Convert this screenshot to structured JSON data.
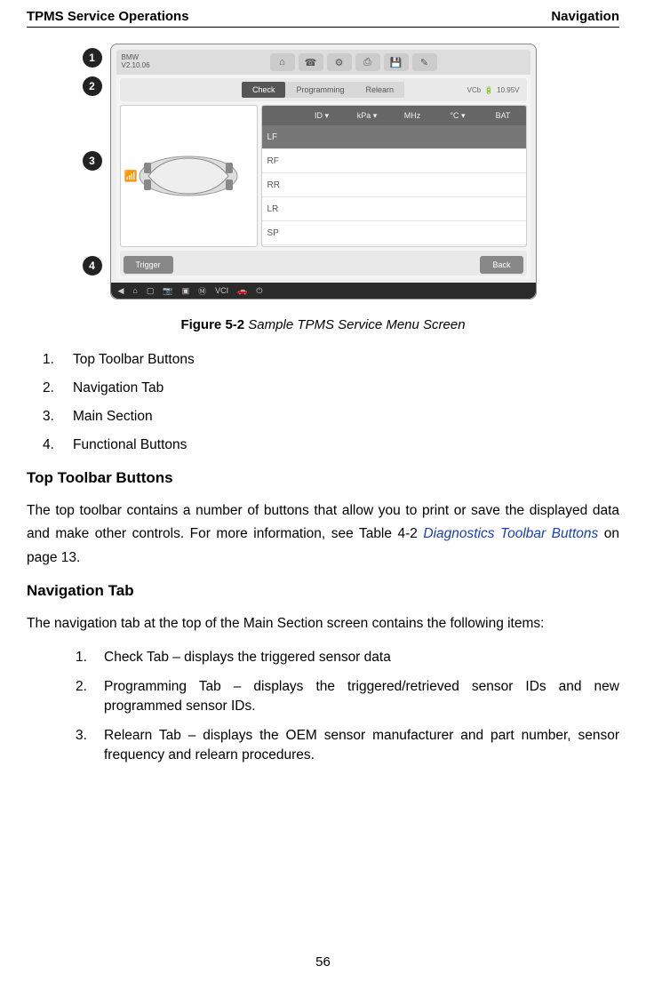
{
  "header": {
    "left": "TPMS Service Operations",
    "right": "Navigation"
  },
  "screenshot": {
    "brand": "BMW",
    "version": "V2.10.06",
    "toolbar_icons": [
      "home-icon",
      "tools-icon",
      "gear-icon",
      "print-icon",
      "save-icon",
      "edit-icon"
    ],
    "nav_tabs": [
      "Check",
      "Programming",
      "Relearn"
    ],
    "status": {
      "vc": "VCb",
      "voltage": "10.95V"
    },
    "table_headers": [
      "ID ▾",
      "kPa ▾",
      "MHz",
      "°C ▾",
      "BAT"
    ],
    "rows": [
      "LF",
      "RF",
      "RR",
      "LR",
      "SP"
    ],
    "func": {
      "left": "Trigger",
      "right": "Back"
    },
    "callouts": [
      "1",
      "2",
      "3",
      "4"
    ]
  },
  "caption": {
    "label": "Figure 5-2",
    "text": "Sample TPMS Service Menu Screen"
  },
  "main_list": [
    "Top Toolbar Buttons",
    "Navigation Tab",
    "Main Section",
    "Functional Buttons"
  ],
  "section1": {
    "title": "Top Toolbar Buttons",
    "para_a": "The top toolbar contains a number of buttons that allow you to print or save the displayed data and make other controls. For more information, see Table 4-2 ",
    "link": "Diagnostics Toolbar Buttons",
    "para_b": " on page 13."
  },
  "section2": {
    "title": "Navigation Tab",
    "para": "The navigation tab at the top of the Main Section screen contains the following items:",
    "items": [
      "Check Tab – displays the triggered sensor data",
      "Programming Tab – displays the triggered/retrieved sensor IDs and new programmed sensor IDs.",
      "Relearn Tab – displays the OEM sensor manufacturer and part number, sensor frequency and relearn procedures."
    ]
  },
  "page_number": "56"
}
